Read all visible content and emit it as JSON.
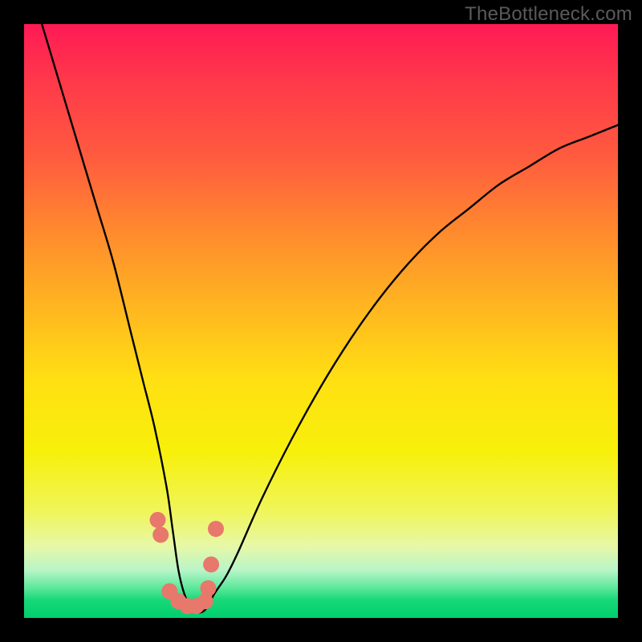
{
  "watermark": "TheBottleneck.com",
  "chart_data": {
    "type": "line",
    "title": "",
    "xlabel": "",
    "ylabel": "",
    "xlim": [
      0,
      100
    ],
    "ylim": [
      0,
      100
    ],
    "series": [
      {
        "name": "bottleneck-curve",
        "x": [
          3,
          6,
          9,
          12,
          15,
          18,
          20,
          22,
          24,
          25,
          26,
          27,
          28,
          29,
          30,
          31,
          32,
          34,
          36,
          40,
          45,
          50,
          55,
          60,
          65,
          70,
          75,
          80,
          85,
          90,
          95,
          100
        ],
        "y_pct": [
          100,
          90,
          80,
          70,
          60,
          48,
          40,
          32,
          22,
          15,
          8,
          4,
          2,
          1,
          1,
          2,
          4,
          7,
          11,
          20,
          30,
          39,
          47,
          54,
          60,
          65,
          69,
          73,
          76,
          79,
          81,
          83
        ]
      }
    ],
    "markers": {
      "name": "highlight-points",
      "x": [
        22.5,
        23.0,
        24.5,
        26.0,
        27.5,
        29.0,
        30.5,
        31.0,
        31.5,
        32.3
      ],
      "y_pct": [
        16.5,
        14.0,
        4.5,
        2.8,
        2.0,
        2.0,
        2.8,
        5.0,
        9.0,
        15.0
      ]
    },
    "gradient_stops": [
      {
        "pos": 0.0,
        "color": "#ff1a55"
      },
      {
        "pos": 0.35,
        "color": "#ff8a2e"
      },
      {
        "pos": 0.6,
        "color": "#ffe012"
      },
      {
        "pos": 0.82,
        "color": "#f0f55a"
      },
      {
        "pos": 0.95,
        "color": "#5ae89a"
      },
      {
        "pos": 1.0,
        "color": "#00cf6e"
      }
    ]
  }
}
